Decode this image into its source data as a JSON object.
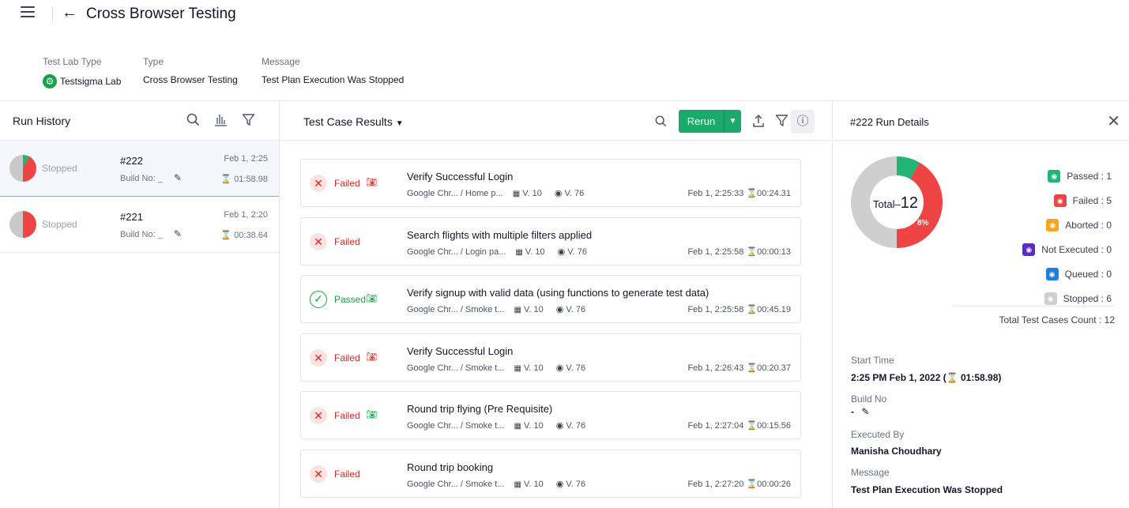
{
  "header": {
    "title": "Cross Browser Testing"
  },
  "meta": {
    "test_lab_type_label": "Test Lab Type",
    "test_lab_type_value": "Testsigma Lab",
    "type_label": "Type",
    "type_value": "Cross Browser Testing",
    "message_label": "Message",
    "message_value": "Test Plan Execution Was Stopped"
  },
  "run_history": {
    "title": "Run History",
    "runs": [
      {
        "status": "Stopped",
        "number": "#222",
        "build": "Build No: _",
        "date": "Feb 1, 2:25",
        "duration": "01:58.98",
        "passed_fraction": 0.08,
        "failed_fraction": 0.42
      },
      {
        "status": "Stopped",
        "number": "#221",
        "build": "Build No: _",
        "date": "Feb 1, 2:20",
        "duration": "00:38.64",
        "passed_fraction": 0,
        "failed_fraction": 0.5
      }
    ]
  },
  "results": {
    "title": "Test Case Results",
    "rerun_label": "Rerun",
    "items": [
      {
        "status": "Failed",
        "status_type": "fail",
        "has_camera": true,
        "camera_color": "#dc2626",
        "name": "Verify Successful Login",
        "browser": "Google Chr...",
        "path": "/ Home p...",
        "os": "V. 10",
        "browser_version": "V. 76",
        "time": "Feb 1, 2:25:33",
        "duration": "00:24.31"
      },
      {
        "status": "Failed",
        "status_type": "fail",
        "has_camera": false,
        "camera_color": "",
        "name": "Search flights with multiple filters applied",
        "browser": "Google Chr...",
        "path": "/ Login pa...",
        "os": "V. 10",
        "browser_version": "V. 76",
        "time": "Feb 1, 2:25:58",
        "duration": "00:00:13"
      },
      {
        "status": "Passed",
        "status_type": "pass",
        "has_camera": true,
        "camera_color": "#16a34a",
        "name": "Verify signup with valid data (using functions to generate test data)",
        "browser": "Google Chr...",
        "path": "/ Smoke t...",
        "os": "V. 10",
        "browser_version": "V. 76",
        "time": "Feb 1, 2:25:58",
        "duration": "00:45.19"
      },
      {
        "status": "Failed",
        "status_type": "fail",
        "has_camera": true,
        "camera_color": "#dc2626",
        "name": "Verify Successful Login",
        "browser": "Google Chr...",
        "path": "/ Smoke t...",
        "os": "V. 10",
        "browser_version": "V. 76",
        "time": "Feb 1, 2:26:43",
        "duration": "00:20.37"
      },
      {
        "status": "Failed",
        "status_type": "fail",
        "has_camera": true,
        "camera_color": "#16a34a",
        "name": "Round trip flying (Pre Requisite)",
        "browser": "Google Chr...",
        "path": "/ Smoke t...",
        "os": "V. 10",
        "browser_version": "V. 76",
        "time": "Feb 1, 2:27:04",
        "duration": "00:15.56"
      },
      {
        "status": "Failed",
        "status_type": "fail",
        "has_camera": false,
        "camera_color": "",
        "name": "Round trip booking",
        "browser": "Google Chr...",
        "path": "/ Smoke t...",
        "os": "V. 10",
        "browser_version": "V. 76",
        "time": "Feb 1, 2:27:20",
        "duration": "00:00:26"
      }
    ]
  },
  "run_details": {
    "title": "#222 Run Details",
    "total_label": "Total",
    "total": "12",
    "passed_pct_label": "8%",
    "counts": [
      {
        "label": "Passed : 1",
        "value": 1,
        "color": "#22b573"
      },
      {
        "label": "Failed : 5",
        "value": 5,
        "color": "#ef4444"
      },
      {
        "label": "Aborted : 0",
        "value": 0,
        "color": "#f5a623"
      },
      {
        "label": "Not Executed : 0",
        "value": 0,
        "color": "#5b2bc4"
      },
      {
        "label": "Queued : 0",
        "value": 0,
        "color": "#1d7fe0"
      },
      {
        "label": "Stopped : 6",
        "value": 6,
        "color": "#cfcfcf"
      }
    ],
    "total_count_label": "Total Test Cases Count : 12",
    "start_time_label": "Start Time",
    "start_time_value": "2:25 PM Feb 1, 2022",
    "start_time_duration": "(⌛ 01:58.98)",
    "build_label": "Build No",
    "build_value": "-",
    "executed_by_label": "Executed By",
    "executed_by_value": "Manisha Choudhary",
    "message_label": "Message",
    "message_value": "Test Plan Execution Was Stopped"
  },
  "icons": {
    "menu": "hamburger-icon",
    "back": "arrow-left-icon",
    "search": "search-icon",
    "chart": "bar-chart-icon",
    "filter": "filter-icon",
    "upload": "upload-icon",
    "info": "info-icon",
    "close": "close-icon",
    "edit": "pencil-icon",
    "camera": "camera-icon"
  }
}
